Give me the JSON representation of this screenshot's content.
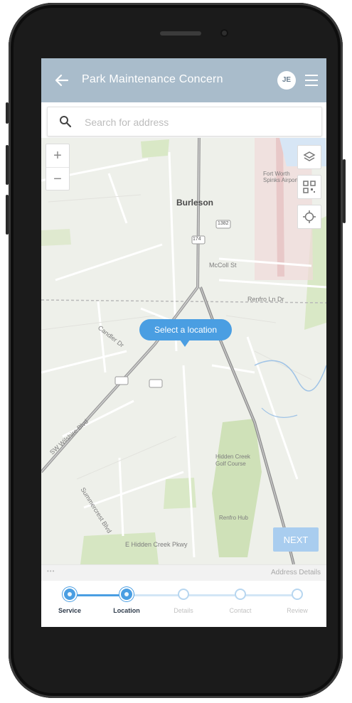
{
  "app": {
    "title": "Park Maintenance Concern",
    "user_initials": "JE"
  },
  "search": {
    "placeholder": "Search for address"
  },
  "map": {
    "zoom_in_label": "+",
    "zoom_out_label": "−",
    "callout_text": "Select a location",
    "labels": {
      "city": "Burleson",
      "mccoll": "McColl St",
      "renfro": "Renfro Ln Dr",
      "fort_worth": "Fort Worth Spinks Airport",
      "golf_course": "Hidden Creek Golf Course",
      "highway_174": "174",
      "highway_1382": "1382",
      "wilshire": "SW Wilshire Blvd",
      "hidden_creek_pkwy": "E Hidden Creek Pkwy",
      "renfro_hub": "Renfro Hub",
      "candler": "Candler Dr",
      "summercrest": "Summercrest Blvd"
    }
  },
  "buttons": {
    "next": "NEXT"
  },
  "details_bar": {
    "handle": "•••",
    "link": "Address Details"
  },
  "stepper": {
    "steps": [
      {
        "label": "Service",
        "state": "active"
      },
      {
        "label": "Location",
        "state": "active"
      },
      {
        "label": "Details",
        "state": "inactive"
      },
      {
        "label": "Contact",
        "state": "inactive"
      },
      {
        "label": "Review",
        "state": "inactive"
      }
    ]
  },
  "colors": {
    "appbar": "#a9bccb",
    "accent": "#4a9ee2",
    "next_button": "#a9cdef",
    "map_background": "#eef0ea",
    "park_green": "#cfe1b8"
  },
  "icons": {
    "back": "arrow-left-icon",
    "menu": "hamburger-menu-icon",
    "search": "magnifier-icon",
    "layers": "layers-icon",
    "qr": "qr-code-icon",
    "locate": "crosshair-locate-icon"
  }
}
